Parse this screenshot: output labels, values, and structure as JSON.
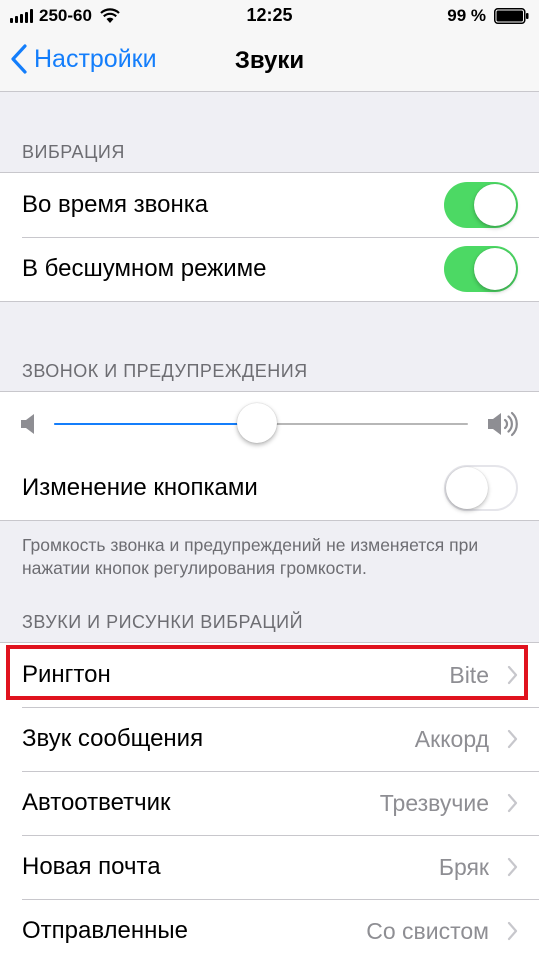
{
  "status_bar": {
    "carrier": "250-60",
    "time": "12:25",
    "battery": "99 %"
  },
  "nav": {
    "back_label": "Настройки",
    "title": "Звуки"
  },
  "vibration": {
    "header": "ВИБРАЦИЯ",
    "rows": [
      {
        "label": "Во время звонка",
        "on": true
      },
      {
        "label": "В бесшумном режиме",
        "on": true
      }
    ]
  },
  "ringer": {
    "header": "ЗВОНОК И ПРЕДУПРЕЖДЕНИЯ",
    "volume_level": 0.49,
    "change_with_buttons": {
      "label": "Изменение кнопками",
      "on": false
    },
    "footer": "Громкость звонка и предупреждений не изменяется при нажатии кнопок регулирования громкости."
  },
  "sounds": {
    "header": "ЗВУКИ И РИСУНКИ ВИБРАЦИЙ",
    "rows": [
      {
        "label": "Рингтон",
        "value": "Bite"
      },
      {
        "label": "Звук сообщения",
        "value": "Аккорд"
      },
      {
        "label": "Автоответчик",
        "value": "Трезвучие"
      },
      {
        "label": "Новая почта",
        "value": "Бряк"
      },
      {
        "label": "Отправленные",
        "value": "Со свистом"
      }
    ]
  },
  "colors": {
    "accent": "#147efb",
    "toggle_on": "#4cd964",
    "highlight": "#e0121e"
  }
}
